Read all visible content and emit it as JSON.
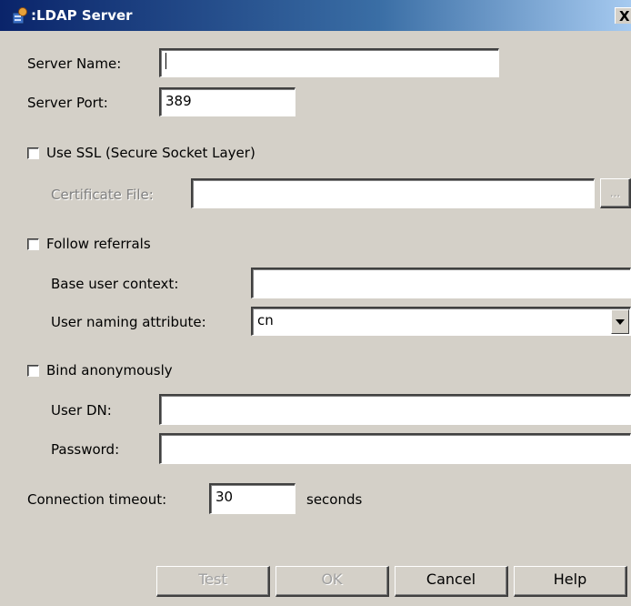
{
  "window": {
    "title": "LDAP Server",
    "icon": "ldap-app-icon",
    "close_label": "X"
  },
  "server_name": {
    "label": "Server Name:",
    "value": ""
  },
  "server_port": {
    "label": "Server Port:",
    "value": "389"
  },
  "use_ssl": {
    "label": "Use SSL (Secure Socket Layer)",
    "checked": false
  },
  "certificate_file": {
    "label": "Certificate File:",
    "value": "",
    "browse_label": "...",
    "enabled": false
  },
  "follow_referrals": {
    "label": "Follow referrals",
    "checked": false
  },
  "base_user_context": {
    "label": "Base user context:",
    "value": ""
  },
  "user_naming_attribute": {
    "label": "User naming attribute:",
    "selected": "cn"
  },
  "bind_anonymously": {
    "label": "Bind anonymously",
    "checked": false
  },
  "user_dn": {
    "label": "User DN:",
    "value": ""
  },
  "password": {
    "label": "Password:",
    "value": ""
  },
  "connection_timeout": {
    "label": "Connection timeout:",
    "value": "30",
    "unit": "seconds"
  },
  "buttons": {
    "test": {
      "label": "Test",
      "enabled": false
    },
    "ok": {
      "label": "OK",
      "enabled": false
    },
    "cancel": {
      "label": "Cancel",
      "enabled": true
    },
    "help": {
      "label": "Help",
      "enabled": true
    }
  },
  "colors": {
    "dialog_bg": "#d4d0c8",
    "titlebar_start": "#0a246a",
    "titlebar_end": "#a6caf0",
    "disabled_text": "#808080"
  }
}
